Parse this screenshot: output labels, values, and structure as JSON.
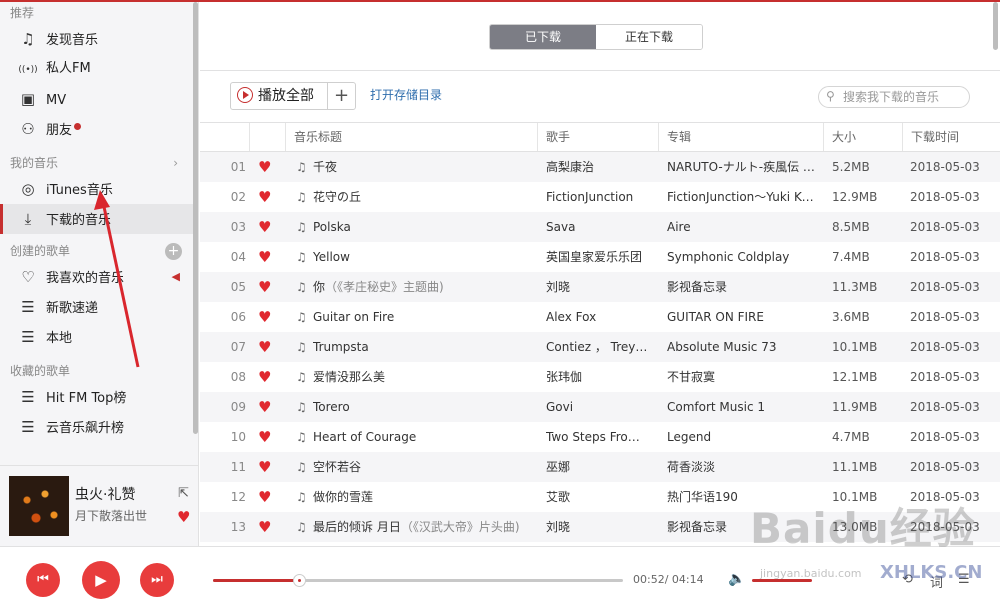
{
  "sidebar": {
    "recommend_label": "推荐",
    "recommend_items": [
      {
        "icon": "music-note-icon",
        "glyph": "♫",
        "label": "发现音乐"
      },
      {
        "icon": "radio-icon",
        "glyph": "((•))",
        "label": "私人FM"
      },
      {
        "icon": "tv-icon",
        "glyph": "▣",
        "label": "MV"
      },
      {
        "icon": "friends-icon",
        "glyph": "⚇",
        "label": "朋友"
      }
    ],
    "my_music_label": "我的音乐",
    "my_music_items": [
      {
        "icon": "itunes-icon",
        "glyph": "◎",
        "label": "iTunes音乐"
      },
      {
        "icon": "download-icon",
        "glyph": "⤓",
        "label": "下载的音乐"
      }
    ],
    "created_label": "创建的歌单",
    "created_items": [
      {
        "icon": "heart-outline-icon",
        "glyph": "♡",
        "label": "我喜欢的音乐"
      },
      {
        "icon": "playlist-icon",
        "glyph": "☰",
        "label": "新歌速递"
      },
      {
        "icon": "playlist-icon",
        "glyph": "☰",
        "label": "本地"
      }
    ],
    "collected_label": "收藏的歌单",
    "collected_items": [
      {
        "icon": "playlist-icon",
        "glyph": "☰",
        "label": "Hit FM Top榜"
      },
      {
        "icon": "playlist-icon",
        "glyph": "☰",
        "label": "云音乐飙升榜"
      }
    ]
  },
  "now_playing": {
    "title": "虫火·礼赞",
    "artist": "月下散落出世"
  },
  "tabs": [
    {
      "label": "已下载",
      "active": true
    },
    {
      "label": "正在下载",
      "active": false
    }
  ],
  "toolbar": {
    "play_all_label": "播放全部",
    "open_dir_label": "打开存储目录",
    "search_placeholder": "搜索我下载的音乐"
  },
  "table": {
    "headers": [
      "音乐标题",
      "歌手",
      "专辑",
      "大小",
      "下载时间"
    ],
    "rows": [
      {
        "no": "01",
        "title": "千夜",
        "sub": "",
        "artist": "高梨康治",
        "album": "NARUTO-ナルト-疾風伝 …",
        "size": "5.2MB",
        "date": "2018-05-03"
      },
      {
        "no": "02",
        "title": "花守の丘",
        "sub": "",
        "artist": "FictionJunction",
        "album": "FictionJunction～Yuki Kaj…",
        "size": "12.9MB",
        "date": "2018-05-03"
      },
      {
        "no": "03",
        "title": "Polska",
        "sub": "",
        "artist": "Sava",
        "album": "Aire",
        "size": "8.5MB",
        "date": "2018-05-03"
      },
      {
        "no": "04",
        "title": "Yellow",
        "sub": "",
        "artist": "英国皇家爱乐乐团",
        "album": "Symphonic Coldplay",
        "size": "7.4MB",
        "date": "2018-05-03"
      },
      {
        "no": "05",
        "title": "你",
        "sub": "（《孝庄秘史》主题曲)",
        "artist": "刘晓",
        "album": "影视备忘录",
        "size": "11.3MB",
        "date": "2018-05-03"
      },
      {
        "no": "06",
        "title": "Guitar on Fire",
        "sub": "",
        "artist": "Alex Fox",
        "album": "GUITAR ON FIRE",
        "size": "3.6MB",
        "date": "2018-05-03"
      },
      {
        "no": "07",
        "title": "Trumpsta",
        "sub": "",
        "artist": "Contiez ， Treyy G",
        "album": "Absolute Music 73",
        "size": "10.1MB",
        "date": "2018-05-03"
      },
      {
        "no": "08",
        "title": "爱情没那么美",
        "sub": "",
        "artist": "张玮伽",
        "album": "不甘寂寞",
        "size": "12.1MB",
        "date": "2018-05-03"
      },
      {
        "no": "09",
        "title": "Torero",
        "sub": "",
        "artist": "Govi",
        "album": "Comfort Music 1",
        "size": "11.9MB",
        "date": "2018-05-03"
      },
      {
        "no": "10",
        "title": "Heart of Courage",
        "sub": "",
        "artist": "Two Steps From …",
        "album": "Legend",
        "size": "4.7MB",
        "date": "2018-05-03"
      },
      {
        "no": "11",
        "title": "空怀若谷",
        "sub": "",
        "artist": "巫娜",
        "album": "荷香淡淡",
        "size": "11.1MB",
        "date": "2018-05-03"
      },
      {
        "no": "12",
        "title": "做你的雪莲",
        "sub": "",
        "artist": "艾歌",
        "album": "热门华语190",
        "size": "10.1MB",
        "date": "2018-05-03"
      },
      {
        "no": "13",
        "title": "最后的倾诉 月日",
        "sub": "（《汉武大帝》片头曲)",
        "artist": "刘晓",
        "album": "影视备忘录",
        "size": "13.0MB",
        "date": "2018-05-03"
      }
    ]
  },
  "player": {
    "time": "00:52/ 04:14",
    "progress_fraction": 0.21,
    "volume_fraction": 0.35
  },
  "watermark": {
    "main": "Baidu经验",
    "sub": "jingyan.baidu.com",
    "site": "XHLKS.CN"
  },
  "colors": {
    "accent": "#c62f2f",
    "heart": "#e0282f",
    "tab_active": "#7c7d85",
    "link": "#2f6ead"
  }
}
